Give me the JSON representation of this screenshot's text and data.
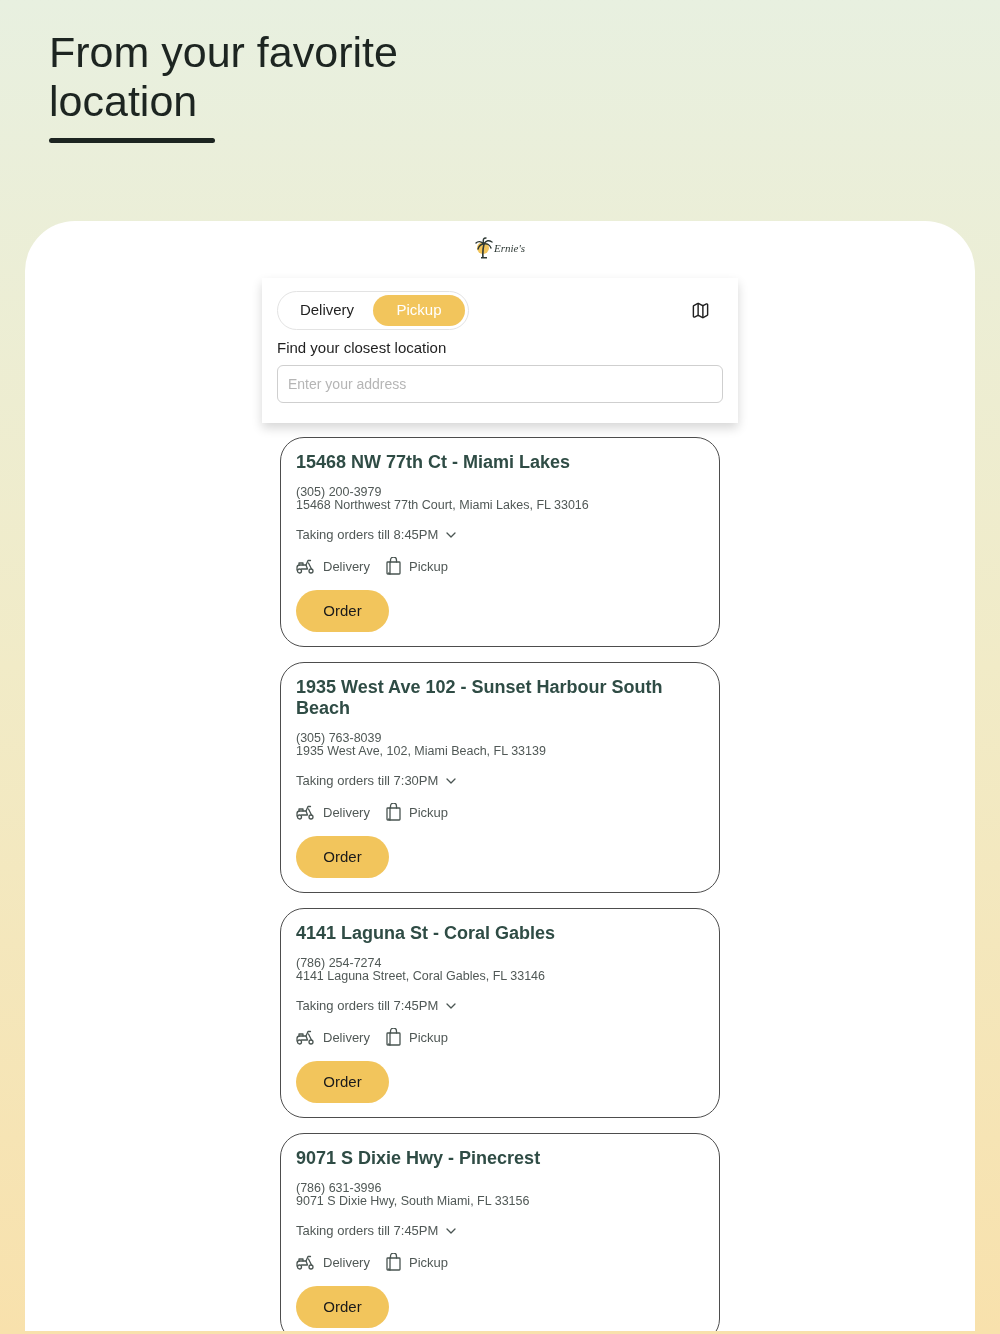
{
  "header": {
    "title": "From your favorite location"
  },
  "brand": {
    "name": "Ernie's"
  },
  "finder": {
    "tabs": [
      {
        "label": "Delivery",
        "selected": false
      },
      {
        "label": "Pickup",
        "selected": true
      }
    ],
    "label": "Find your closest location",
    "address": {
      "placeholder": "Enter your address"
    }
  },
  "locations": [
    {
      "name": "15468 NW 77th Ct - Miami Lakes",
      "phone": "(305) 200-3979",
      "address": "15468 Northwest 77th Court, Miami Lakes, FL 33016",
      "hours": {
        "text": "Taking orders till 8:45PM",
        "expanded": false
      },
      "services": [
        {
          "kind": "delivery",
          "label": "Delivery"
        },
        {
          "kind": "pickup",
          "label": "Pickup"
        }
      ],
      "button": "Order"
    },
    {
      "name": "1935 West Ave 102 - Sunset Harbour South Beach",
      "phone": "(305) 763-8039",
      "address": "1935 West Ave, 102, Miami Beach, FL 33139",
      "hours": {
        "text": "Taking orders till 7:30PM",
        "expanded": false
      },
      "services": [
        {
          "kind": "delivery",
          "label": "Delivery"
        },
        {
          "kind": "pickup",
          "label": "Pickup"
        }
      ],
      "button": "Order"
    },
    {
      "name": "4141 Laguna St - Coral Gables",
      "phone": "(786) 254-7274",
      "address": "4141 Laguna Street, Coral Gables, FL 33146",
      "hours": {
        "text": "Taking orders till 7:45PM",
        "expanded": false
      },
      "services": [
        {
          "kind": "delivery",
          "label": "Delivery"
        },
        {
          "kind": "pickup",
          "label": "Pickup"
        }
      ],
      "button": "Order"
    },
    {
      "name": "9071 S Dixie Hwy - Pinecrest",
      "phone": "(786) 631-3996",
      "address": "9071 S Dixie Hwy, South Miami, FL 33156",
      "hours": {
        "text": "Taking orders till 7:45PM",
        "expanded": false
      },
      "services": [
        {
          "kind": "delivery",
          "label": "Delivery"
        },
        {
          "kind": "pickup",
          "label": "Pickup"
        }
      ],
      "button": "Order"
    }
  ]
}
